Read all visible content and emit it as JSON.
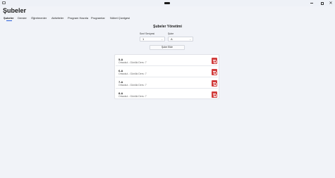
{
  "window": {
    "minimize_icon": "minimize-icon",
    "maximize_icon": "maximize-icon",
    "close_icon": "close-icon"
  },
  "page": {
    "title": "Şubeler"
  },
  "tabs": [
    {
      "label": "Şubeler",
      "active": true
    },
    {
      "label": "Dersler"
    },
    {
      "label": "Öğretmenler"
    },
    {
      "label": "Aktiviteler"
    },
    {
      "label": "Program Hazırla"
    },
    {
      "label": "Programlar"
    },
    {
      "label": "Nöbet Çizelgesi"
    }
  ],
  "main": {
    "title": "Şubeler Yönetimi",
    "class_level": {
      "label": "Sınıf Seviyesi",
      "value": "1"
    },
    "branch": {
      "label": "Şube",
      "value": "A"
    },
    "add_button": "Şube Ekle"
  },
  "branches": [
    {
      "name": "5-A",
      "detail": "Ortaokul - Günlük Ders: 7"
    },
    {
      "name": "6-A",
      "detail": "Ortaokul - Günlük Ders: 7"
    },
    {
      "name": "7-A",
      "detail": "Ortaokul - Günlük Ders: 7"
    },
    {
      "name": "8-A",
      "detail": "Ortaokul - Günlük Ders: 7"
    }
  ],
  "colors": {
    "accent": "#2b5fd9",
    "danger": "#d13d3d"
  }
}
